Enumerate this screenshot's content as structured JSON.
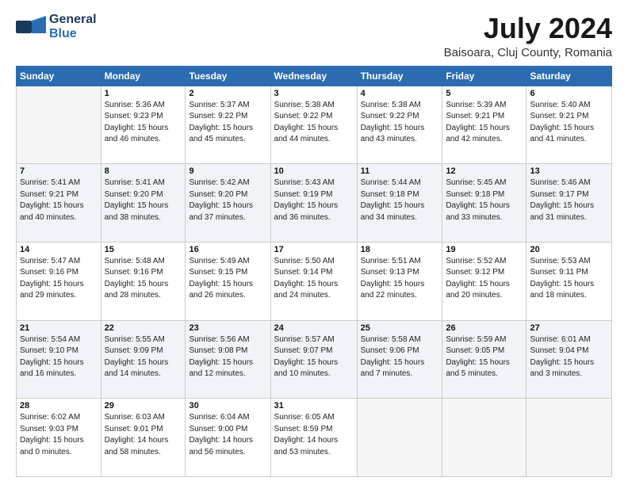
{
  "logo": {
    "line1": "General",
    "line2": "Blue"
  },
  "title": "July 2024",
  "subtitle": "Baisoara, Cluj County, Romania",
  "headers": [
    "Sunday",
    "Monday",
    "Tuesday",
    "Wednesday",
    "Thursday",
    "Friday",
    "Saturday"
  ],
  "weeks": [
    [
      {
        "day": "",
        "info": ""
      },
      {
        "day": "1",
        "info": "Sunrise: 5:36 AM\nSunset: 9:23 PM\nDaylight: 15 hours\nand 46 minutes."
      },
      {
        "day": "2",
        "info": "Sunrise: 5:37 AM\nSunset: 9:22 PM\nDaylight: 15 hours\nand 45 minutes."
      },
      {
        "day": "3",
        "info": "Sunrise: 5:38 AM\nSunset: 9:22 PM\nDaylight: 15 hours\nand 44 minutes."
      },
      {
        "day": "4",
        "info": "Sunrise: 5:38 AM\nSunset: 9:22 PM\nDaylight: 15 hours\nand 43 minutes."
      },
      {
        "day": "5",
        "info": "Sunrise: 5:39 AM\nSunset: 9:21 PM\nDaylight: 15 hours\nand 42 minutes."
      },
      {
        "day": "6",
        "info": "Sunrise: 5:40 AM\nSunset: 9:21 PM\nDaylight: 15 hours\nand 41 minutes."
      }
    ],
    [
      {
        "day": "7",
        "info": "Sunrise: 5:41 AM\nSunset: 9:21 PM\nDaylight: 15 hours\nand 40 minutes."
      },
      {
        "day": "8",
        "info": "Sunrise: 5:41 AM\nSunset: 9:20 PM\nDaylight: 15 hours\nand 38 minutes."
      },
      {
        "day": "9",
        "info": "Sunrise: 5:42 AM\nSunset: 9:20 PM\nDaylight: 15 hours\nand 37 minutes."
      },
      {
        "day": "10",
        "info": "Sunrise: 5:43 AM\nSunset: 9:19 PM\nDaylight: 15 hours\nand 36 minutes."
      },
      {
        "day": "11",
        "info": "Sunrise: 5:44 AM\nSunset: 9:18 PM\nDaylight: 15 hours\nand 34 minutes."
      },
      {
        "day": "12",
        "info": "Sunrise: 5:45 AM\nSunset: 9:18 PM\nDaylight: 15 hours\nand 33 minutes."
      },
      {
        "day": "13",
        "info": "Sunrise: 5:46 AM\nSunset: 9:17 PM\nDaylight: 15 hours\nand 31 minutes."
      }
    ],
    [
      {
        "day": "14",
        "info": "Sunrise: 5:47 AM\nSunset: 9:16 PM\nDaylight: 15 hours\nand 29 minutes."
      },
      {
        "day": "15",
        "info": "Sunrise: 5:48 AM\nSunset: 9:16 PM\nDaylight: 15 hours\nand 28 minutes."
      },
      {
        "day": "16",
        "info": "Sunrise: 5:49 AM\nSunset: 9:15 PM\nDaylight: 15 hours\nand 26 minutes."
      },
      {
        "day": "17",
        "info": "Sunrise: 5:50 AM\nSunset: 9:14 PM\nDaylight: 15 hours\nand 24 minutes."
      },
      {
        "day": "18",
        "info": "Sunrise: 5:51 AM\nSunset: 9:13 PM\nDaylight: 15 hours\nand 22 minutes."
      },
      {
        "day": "19",
        "info": "Sunrise: 5:52 AM\nSunset: 9:12 PM\nDaylight: 15 hours\nand 20 minutes."
      },
      {
        "day": "20",
        "info": "Sunrise: 5:53 AM\nSunset: 9:11 PM\nDaylight: 15 hours\nand 18 minutes."
      }
    ],
    [
      {
        "day": "21",
        "info": "Sunrise: 5:54 AM\nSunset: 9:10 PM\nDaylight: 15 hours\nand 16 minutes."
      },
      {
        "day": "22",
        "info": "Sunrise: 5:55 AM\nSunset: 9:09 PM\nDaylight: 15 hours\nand 14 minutes."
      },
      {
        "day": "23",
        "info": "Sunrise: 5:56 AM\nSunset: 9:08 PM\nDaylight: 15 hours\nand 12 minutes."
      },
      {
        "day": "24",
        "info": "Sunrise: 5:57 AM\nSunset: 9:07 PM\nDaylight: 15 hours\nand 10 minutes."
      },
      {
        "day": "25",
        "info": "Sunrise: 5:58 AM\nSunset: 9:06 PM\nDaylight: 15 hours\nand 7 minutes."
      },
      {
        "day": "26",
        "info": "Sunrise: 5:59 AM\nSunset: 9:05 PM\nDaylight: 15 hours\nand 5 minutes."
      },
      {
        "day": "27",
        "info": "Sunrise: 6:01 AM\nSunset: 9:04 PM\nDaylight: 15 hours\nand 3 minutes."
      }
    ],
    [
      {
        "day": "28",
        "info": "Sunrise: 6:02 AM\nSunset: 9:03 PM\nDaylight: 15 hours\nand 0 minutes."
      },
      {
        "day": "29",
        "info": "Sunrise: 6:03 AM\nSunset: 9:01 PM\nDaylight: 14 hours\nand 58 minutes."
      },
      {
        "day": "30",
        "info": "Sunrise: 6:04 AM\nSunset: 9:00 PM\nDaylight: 14 hours\nand 56 minutes."
      },
      {
        "day": "31",
        "info": "Sunrise: 6:05 AM\nSunset: 8:59 PM\nDaylight: 14 hours\nand 53 minutes."
      },
      {
        "day": "",
        "info": ""
      },
      {
        "day": "",
        "info": ""
      },
      {
        "day": "",
        "info": ""
      }
    ]
  ]
}
